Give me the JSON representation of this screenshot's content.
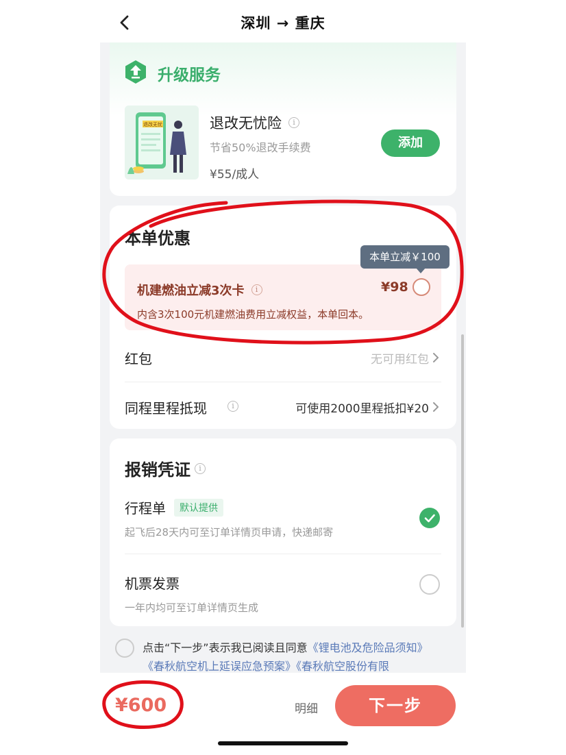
{
  "header": {
    "title": "深圳 → 重庆"
  },
  "upgrade": {
    "title": "升级服务",
    "image_caption": "退改无忧",
    "insurance_name": "退改无忧险",
    "insurance_desc": "节省50%退改手续费",
    "insurance_price": "¥55/成人",
    "add_label": "添加"
  },
  "discount": {
    "title": "本单优惠",
    "tooltip": "本单立减￥100",
    "fuel_card_name": "机建燃油立减3次卡",
    "fuel_card_price": "¥98",
    "fuel_card_desc": "内含3次100元机建燃油费用立减权益，本单回本。",
    "red_packet_label": "红包",
    "red_packet_value": "无可用红包",
    "mileage_label": "同程里程抵现",
    "mileage_value": "可使用2000里程抵扣¥20"
  },
  "invoice": {
    "title": "报销凭证",
    "itinerary_label": "行程单",
    "itinerary_tag": "默认提供",
    "itinerary_desc": "起飞后28天内可至订单详情页申请，快递邮寄",
    "ticket_invoice_label": "机票发票",
    "ticket_invoice_desc": "一年内均可至订单详情页生成"
  },
  "agreement": {
    "prefix": "点击“下一步”表示我已阅读且同意",
    "link1": "《锂电池及危险品须知》",
    "link2": "《春秋航空机上延误应急预案》",
    "link3": "《春秋航空股份有限"
  },
  "bottom": {
    "total_price": "¥600",
    "detail_label": "明细",
    "next_label": "下一步"
  },
  "colors": {
    "brand_green": "#3db26a",
    "next_button": "#ee6d62",
    "price_red": "#ea6a5f",
    "fuel_card_bg": "#fdeeee",
    "annotation_red": "#e0101a"
  },
  "icons": [
    "back-chevron-icon",
    "upgrade-arrow-icon",
    "info-icon",
    "chevron-right-icon",
    "checkmark-icon"
  ]
}
